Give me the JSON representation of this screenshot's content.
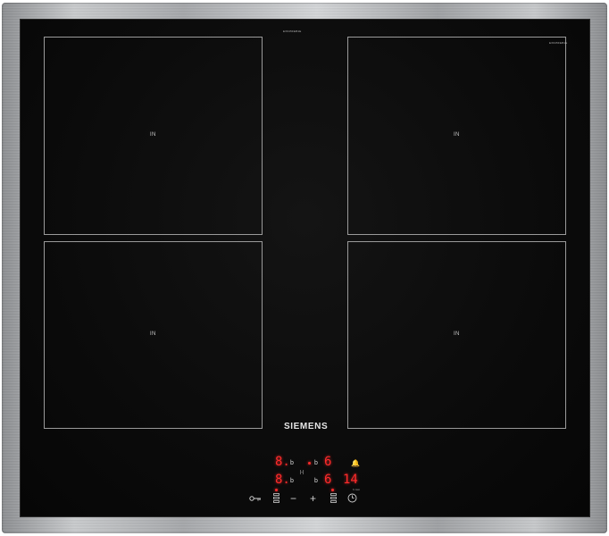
{
  "hob": {
    "model_label_left": "EX645FEB1E",
    "model_label_right": "EX645FEB1E",
    "brand": "SIEMENS",
    "zones": [
      {
        "label": "IN"
      },
      {
        "label": "IN"
      },
      {
        "label": "IN"
      },
      {
        "label": "IN"
      }
    ]
  },
  "display": {
    "row1": {
      "left_value": "8.",
      "left_small": "b",
      "right_small": "b",
      "right_value": "6"
    },
    "row2": {
      "left_value": "8.",
      "left_small": "b",
      "right_small": "b",
      "right_value": "6",
      "timer_value": "14"
    },
    "sync_symbol": "|-|",
    "timer_sub": "h:min"
  },
  "controls": {
    "minus": "−",
    "plus": "+"
  }
}
